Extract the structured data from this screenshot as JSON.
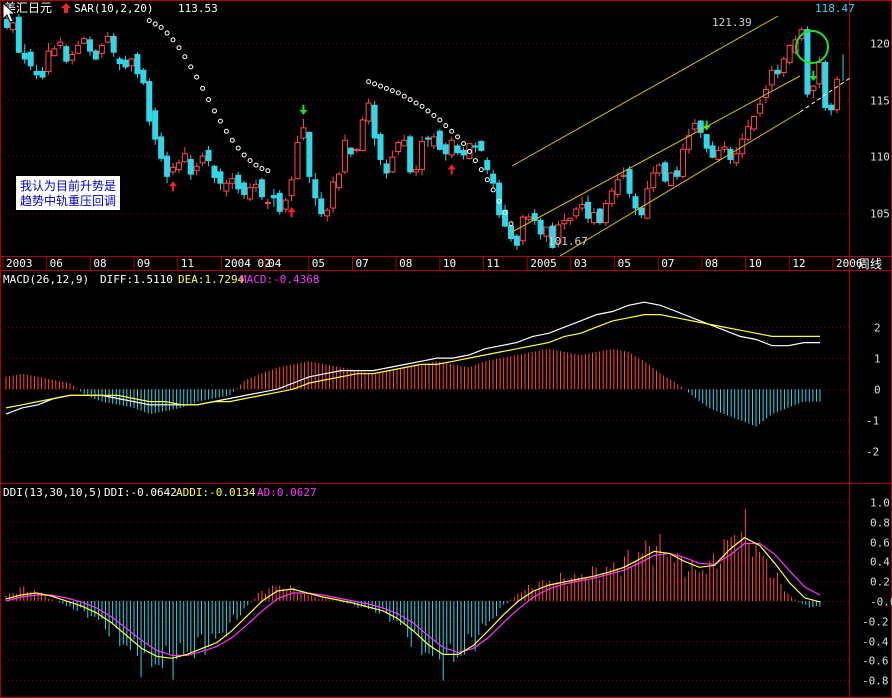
{
  "colors": {
    "background": "#000000",
    "frame": "#b00000",
    "grid": "#7a0000",
    "up": "#ff4a4a",
    "down": "#33d6e8",
    "white": "#ffffff",
    "yellow": "#ffff3a",
    "magenta": "#ff33ff",
    "sar": "#ffffff",
    "channel": "#d7c000",
    "arrow_up": "#ff2020",
    "arrow_down": "#20e020",
    "circle": "#20e020",
    "last_price": "#3ad8ff",
    "note_bg": "#ffffff",
    "note_text": "#0000c8"
  },
  "header": {
    "symbol": "美汇日元",
    "indicator": "SAR(10,2,20)",
    "indicator_value": "113.53",
    "last_price": "118.47",
    "high_label": "121.39",
    "low_label": "101.67"
  },
  "note": {
    "line1": "我认为目前升势是",
    "line2": "趋势中轨重压回调"
  },
  "period": "周线",
  "time_axis": [
    "2003",
    "06",
    "08",
    "09",
    "11",
    "2004 02",
    "04",
    "05",
    "07",
    "08",
    "10",
    "11",
    "2005",
    "03",
    "05",
    "07",
    "08",
    "10",
    "12",
    "2006"
  ],
  "macd": {
    "name": "MACD(26,12,9)",
    "diff_label": "DIFF:1.5110",
    "dea_label": "DEA:1.7294",
    "macd_label": "MACD:-0.4368",
    "ticks": [
      "2",
      "1",
      "0",
      "-1",
      "-2"
    ]
  },
  "ddi": {
    "name": "DDI(13,30,10,5)",
    "ddi_label": "DDI:-0.0642",
    "addi_label": "ADDI:-0.0134",
    "ad_label": "AD:0.0627",
    "ticks": [
      "1.0",
      "0.8",
      "0.6",
      "0.4",
      "0.2",
      "-0.0",
      "-0.2",
      "-0.4",
      "-0.6",
      "-0.8"
    ]
  },
  "chart_data": [
    {
      "type": "candlestick",
      "ylim": [
        101.5,
        122.5
      ],
      "y_ticks": [
        105,
        110,
        115,
        120
      ],
      "grid": true,
      "legend_position": "top-left",
      "close": [
        121.4,
        121.8,
        119.2,
        118.6,
        118.0,
        117.2,
        117.0,
        119.3,
        119.5,
        120.1,
        118.4,
        119.0,
        119.8,
        120.4,
        119.3,
        118.6,
        119.8,
        120.6,
        119.2,
        118.2,
        117.9,
        118.6,
        117.3,
        116.5,
        113.1,
        111.5,
        109.8,
        108.2,
        109.0,
        109.4,
        110.2,
        108.4,
        109.1,
        110.0,
        109.6,
        108.1,
        107.6,
        107.6,
        108.0,
        107.1,
        106.6,
        107.2,
        107.5,
        106.4,
        105.9,
        106.3,
        105.1,
        106.1,
        107.9,
        111.2,
        112.5,
        108.2,
        106.3,
        104.9,
        105.2,
        107.7,
        108.4,
        111.4,
        110.2,
        110.6,
        113.2,
        114.7,
        111.6,
        109.7,
        108.5,
        109.9,
        111.2,
        111.4,
        108.6,
        108.8,
        111.3,
        111.5,
        111.7,
        110.6,
        110.2,
        111.4,
        110.3,
        110.1,
        111.1,
        110.8,
        110.5,
        108.8,
        107.6,
        104.8,
        103.8,
        102.7,
        102.1,
        104.6,
        104.6,
        104.3,
        103.1,
        103.7,
        101.9,
        103.9,
        104.3,
        104.5,
        105.3,
        105.7,
        104.5,
        105.0,
        104.1,
        105.8,
        106.9,
        107.9,
        108.3,
        106.7,
        105.4,
        104.8,
        107.1,
        108.5,
        109.2,
        107.8,
        108.5,
        108.2,
        110.6,
        111.8,
        112.9,
        112.1,
        110.7,
        109.9,
        110.5,
        110.8,
        109.7,
        110.2,
        111.5,
        112.6,
        113.5,
        114.6,
        115.9,
        117.6,
        117.3,
        118.6,
        119.8,
        120.3,
        121.2,
        115.5,
        116.2,
        118.3,
        114.3,
        114.1,
        116.8,
        118.5
      ],
      "open": [
        122.1,
        121.2,
        122.3,
        119.1,
        119.2,
        117.5,
        117.5,
        117.5,
        118.9,
        119.8,
        119.7,
        118.5,
        119.1,
        120.0,
        120.3,
        119.3,
        119.1,
        120.1,
        120.6,
        118.6,
        118.5,
        118.0,
        119.0,
        117.6,
        116.6,
        114.0,
        111.7,
        110.0,
        108.6,
        108.8,
        109.5,
        109.7,
        108.7,
        109.4,
        110.5,
        109.1,
        108.6,
        106.9,
        107.6,
        108.3,
        107.6,
        106.2,
        107.2,
        107.9,
        105.8,
        106.5,
        106.7,
        105.3,
        106.5,
        108.0,
        111.6,
        112.1,
        107.9,
        106.2,
        104.7,
        105.4,
        107.2,
        108.6,
        110.7,
        110.5,
        110.5,
        113.1,
        114.5,
        111.9,
        109.3,
        108.6,
        110.4,
        110.9,
        111.7,
        108.6,
        108.8,
        111.6,
        110.9,
        112.2,
        111.0,
        110.1,
        110.9,
        110.5,
        109.8,
        110.9,
        111.3,
        109.6,
        108.4,
        107.6,
        105.2,
        103.8,
        102.9,
        102.5,
        104.4,
        104.9,
        104.3,
        102.9,
        103.8,
        102.3,
        104.0,
        104.3,
        104.7,
        105.4,
        105.9,
        104.1,
        105.3,
        104.1,
        105.8,
        106.6,
        108.2,
        108.8,
        106.4,
        105.4,
        104.5,
        107.2,
        108.5,
        109.4,
        107.4,
        108.7,
        108.2,
        110.6,
        112.4,
        113.1,
        111.9,
        110.9,
        109.7,
        110.6,
        110.6,
        109.4,
        110.2,
        111.5,
        112.4,
        113.8,
        115.2,
        116.3,
        117.6,
        117.4,
        118.3,
        119.2,
        120.4,
        121.2,
        115.8,
        116.4,
        118.3,
        114.5,
        114.1
      ],
      "high": [
        122.5,
        122.2,
        122.6,
        119.9,
        119.5,
        118.1,
        117.9,
        120.0,
        119.8,
        120.5,
        119.9,
        119.3,
        120.2,
        120.6,
        120.6,
        119.5,
        120.0,
        121.0,
        120.9,
        118.8,
        118.9,
        118.7,
        119.2,
        117.8,
        116.9,
        114.3,
        112.1,
        110.4,
        109.4,
        109.7,
        110.8,
        110.1,
        109.4,
        110.3,
        110.9,
        109.2,
        108.9,
        107.9,
        108.5,
        108.6,
        107.8,
        107.6,
        107.9,
        108.1,
        106.2,
        107.1,
        107.0,
        106.3,
        108.2,
        111.8,
        113.3,
        112.2,
        108.5,
        106.8,
        105.4,
        108.2,
        108.6,
        111.9,
        110.8,
        110.7,
        113.5,
        115.1,
        114.9,
        112.1,
        109.7,
        110.5,
        111.4,
        111.9,
        111.9,
        109.2,
        111.8,
        111.8,
        112.0,
        112.4,
        111.2,
        111.7,
        111.1,
        110.8,
        111.1,
        111.2,
        111.4,
        109.9,
        108.8,
        107.9,
        105.7,
        103.9,
        103.1,
        104.8,
        104.9,
        105.3,
        104.5,
        103.7,
        104.1,
        104.2,
        104.9,
        104.5,
        105.5,
        106.4,
        106.5,
        105.4,
        105.4,
        106.1,
        107.2,
        108.5,
        109.0,
        109.1,
        106.7,
        105.6,
        107.8,
        109.1,
        109.4,
        109.6,
        108.6,
        109.1,
        111.1,
        112.4,
        113.3,
        113.2,
        111.9,
        111.3,
        110.9,
        111.3,
        110.8,
        110.8,
        112.0,
        113.2,
        113.6,
        115.1,
        116.3,
        118.0,
        118.1,
        118.8,
        119.9,
        120.7,
        121.4,
        121.5,
        116.3,
        118.8,
        118.5,
        114.7,
        117.1,
        119.0
      ],
      "low": [
        121.2,
        120.9,
        119.1,
        118.2,
        117.6,
        116.8,
        116.8,
        117.2,
        118.8,
        119.5,
        118.2,
        118.1,
        119.0,
        119.9,
        118.9,
        118.5,
        118.7,
        120.0,
        118.8,
        117.6,
        117.7,
        117.5,
        116.9,
        116.3,
        112.7,
        111.0,
        109.5,
        107.6,
        108.3,
        108.5,
        109.4,
        107.9,
        108.3,
        109.1,
        109.1,
        107.6,
        107.0,
        106.4,
        107.1,
        106.7,
        106.2,
        106.0,
        106.8,
        106.1,
        105.3,
        105.5,
        104.8,
        105.0,
        106.0,
        107.9,
        111.4,
        107.6,
        105.6,
        104.6,
        104.2,
        105.0,
        106.9,
        108.4,
        109.9,
        110.3,
        110.4,
        112.8,
        110.9,
        109.2,
        108.0,
        108.5,
        110.1,
        110.9,
        108.4,
        108.2,
        108.3,
        110.8,
        110.6,
        110.5,
        109.6,
        109.8,
        110.1,
        109.7,
        109.7,
        110.3,
        110.4,
        108.4,
        107.2,
        104.5,
        103.7,
        102.4,
        101.7,
        102.1,
        104.2,
        103.9,
        102.6,
        102.4,
        101.8,
        101.9,
        103.5,
        103.9,
        104.4,
        105.1,
        104.1,
        103.9,
        103.9,
        103.8,
        105.5,
        106.3,
        108.0,
        106.3,
        104.8,
        104.5,
        104.4,
        106.8,
        108.2,
        107.6,
        107.3,
        107.9,
        108.0,
        110.2,
        112.1,
        111.6,
        110.3,
        109.8,
        109.5,
        110.3,
        109.3,
        109.1,
        109.8,
        111.3,
        112.2,
        113.5,
        114.7,
        115.8,
        116.9,
        117.0,
        118.1,
        119.0,
        120.2,
        115.2,
        115.1,
        116.0,
        114.0,
        113.6,
        113.8,
        116.7
      ],
      "sar": [
        null,
        null,
        null,
        null,
        null,
        null,
        null,
        null,
        null,
        null,
        null,
        null,
        null,
        null,
        null,
        null,
        null,
        null,
        null,
        null,
        null,
        null,
        null,
        null,
        122.0,
        121.7,
        121.4,
        120.9,
        120.3,
        119.6,
        118.8,
        117.9,
        117.0,
        116.0,
        115.0,
        114.0,
        113.1,
        112.2,
        111.4,
        110.7,
        110.1,
        109.6,
        109.2,
        108.9,
        108.7,
        null,
        null,
        null,
        null,
        null,
        null,
        null,
        null,
        null,
        null,
        null,
        null,
        null,
        null,
        null,
        null,
        116.6,
        116.4,
        116.2,
        116.0,
        115.8,
        115.6,
        115.3,
        115.0,
        114.7,
        114.4,
        114.0,
        113.6,
        113.2,
        112.7,
        112.2,
        111.7,
        111.1,
        110.4,
        109.6,
        108.8,
        107.9,
        107.0,
        106.0,
        105.0,
        104.0,
        null,
        null,
        null,
        null,
        null,
        null,
        null,
        null,
        null,
        null,
        null,
        null,
        null,
        null,
        null,
        null,
        null,
        null,
        null,
        null,
        null,
        null,
        null,
        null,
        null,
        null,
        null,
        null,
        null,
        null,
        null,
        null,
        null,
        null,
        null,
        null,
        null,
        null,
        null,
        null,
        null,
        null,
        null,
        null,
        null,
        null,
        null,
        null,
        null,
        null,
        null,
        null,
        null,
        null,
        null,
        null,
        null,
        null
      ]
    },
    {
      "type": "line",
      "ylim": [
        -2.6,
        3.0
      ],
      "series": [
        {
          "name": "DIFF",
          "values": [
            -0.8,
            -0.6,
            -0.5,
            -0.3,
            -0.2,
            -0.2,
            -0.2,
            -0.3,
            -0.4,
            -0.5,
            -0.5,
            -0.5,
            -0.5,
            -0.4,
            -0.3,
            -0.2,
            -0.1,
            0.0,
            0.2,
            0.4,
            0.5,
            0.6,
            0.6,
            0.6,
            0.7,
            0.8,
            0.9,
            1.0,
            1.0,
            1.1,
            1.3,
            1.4,
            1.5,
            1.7,
            1.8,
            2.0,
            2.2,
            2.4,
            2.5,
            2.7,
            2.8,
            2.7,
            2.5,
            2.3,
            2.1,
            1.9,
            1.7,
            1.6,
            1.4,
            1.4,
            1.5,
            1.5
          ]
        },
        {
          "name": "DEA",
          "values": [
            -0.6,
            -0.5,
            -0.4,
            -0.3,
            -0.2,
            -0.2,
            -0.2,
            -0.2,
            -0.3,
            -0.4,
            -0.4,
            -0.5,
            -0.5,
            -0.4,
            -0.4,
            -0.3,
            -0.2,
            -0.1,
            0.0,
            0.2,
            0.3,
            0.4,
            0.5,
            0.5,
            0.6,
            0.7,
            0.8,
            0.8,
            0.9,
            1.0,
            1.1,
            1.2,
            1.3,
            1.4,
            1.5,
            1.7,
            1.8,
            2.0,
            2.2,
            2.3,
            2.4,
            2.4,
            2.3,
            2.2,
            2.1,
            2.0,
            1.9,
            1.8,
            1.7,
            1.7,
            1.7,
            1.7
          ]
        },
        {
          "name": "MACD",
          "values": [
            0.4,
            0.5,
            0.4,
            0.3,
            0.2,
            -0.2,
            -0.4,
            -0.5,
            -0.6,
            -0.8,
            -0.7,
            -0.6,
            -0.4,
            -0.3,
            -0.2,
            0.3,
            0.5,
            0.7,
            0.8,
            0.9,
            0.8,
            0.7,
            0.6,
            0.5,
            0.6,
            0.7,
            0.8,
            0.9,
            0.8,
            0.7,
            0.9,
            1.0,
            1.1,
            1.2,
            1.3,
            1.2,
            1.1,
            1.2,
            1.3,
            1.2,
            0.9,
            0.5,
            0.2,
            -0.2,
            -0.6,
            -0.8,
            -1.0,
            -1.2,
            -0.8,
            -0.6,
            -0.4,
            -0.4
          ]
        }
      ]
    },
    {
      "type": "line",
      "ylim": [
        -0.9,
        1.05
      ],
      "series": [
        {
          "name": "DDI",
          "values": [
            0.05,
            0.12,
            0.1,
            0.02,
            -0.05,
            -0.1,
            -0.18,
            -0.3,
            -0.45,
            -0.58,
            -0.62,
            -0.6,
            -0.52,
            -0.44,
            -0.38,
            -0.22,
            -0.05,
            0.1,
            0.15,
            0.12,
            0.06,
            0.02,
            0.0,
            -0.04,
            -0.08,
            -0.12,
            -0.22,
            -0.38,
            -0.52,
            -0.6,
            -0.55,
            -0.4,
            -0.22,
            -0.05,
            0.08,
            0.15,
            0.2,
            0.22,
            0.24,
            0.28,
            0.32,
            0.38,
            0.48,
            0.55,
            0.48,
            0.35,
            0.3,
            0.38,
            0.62,
            0.7,
            0.48,
            0.25,
            0.05,
            -0.05,
            -0.06
          ]
        },
        {
          "name": "ADDI",
          "values": [
            0.02,
            0.06,
            0.08,
            0.05,
            0.0,
            -0.05,
            -0.12,
            -0.22,
            -0.35,
            -0.48,
            -0.56,
            -0.58,
            -0.54,
            -0.48,
            -0.42,
            -0.3,
            -0.15,
            0.0,
            0.1,
            0.12,
            0.08,
            0.04,
            0.01,
            -0.02,
            -0.06,
            -0.1,
            -0.18,
            -0.3,
            -0.44,
            -0.54,
            -0.54,
            -0.45,
            -0.3,
            -0.14,
            0.0,
            0.1,
            0.16,
            0.19,
            0.22,
            0.25,
            0.29,
            0.34,
            0.42,
            0.5,
            0.48,
            0.4,
            0.34,
            0.36,
            0.52,
            0.64,
            0.56,
            0.38,
            0.18,
            0.03,
            -0.01
          ]
        },
        {
          "name": "AD",
          "values": [
            0.0,
            0.04,
            0.06,
            0.06,
            0.03,
            -0.01,
            -0.07,
            -0.16,
            -0.28,
            -0.4,
            -0.5,
            -0.55,
            -0.55,
            -0.51,
            -0.46,
            -0.37,
            -0.24,
            -0.1,
            0.02,
            0.08,
            0.08,
            0.06,
            0.03,
            0.0,
            -0.03,
            -0.07,
            -0.13,
            -0.22,
            -0.35,
            -0.47,
            -0.52,
            -0.48,
            -0.37,
            -0.22,
            -0.08,
            0.04,
            0.12,
            0.17,
            0.2,
            0.23,
            0.27,
            0.31,
            0.38,
            0.46,
            0.48,
            0.44,
            0.38,
            0.37,
            0.46,
            0.58,
            0.58,
            0.47,
            0.3,
            0.14,
            0.06
          ]
        }
      ]
    }
  ]
}
